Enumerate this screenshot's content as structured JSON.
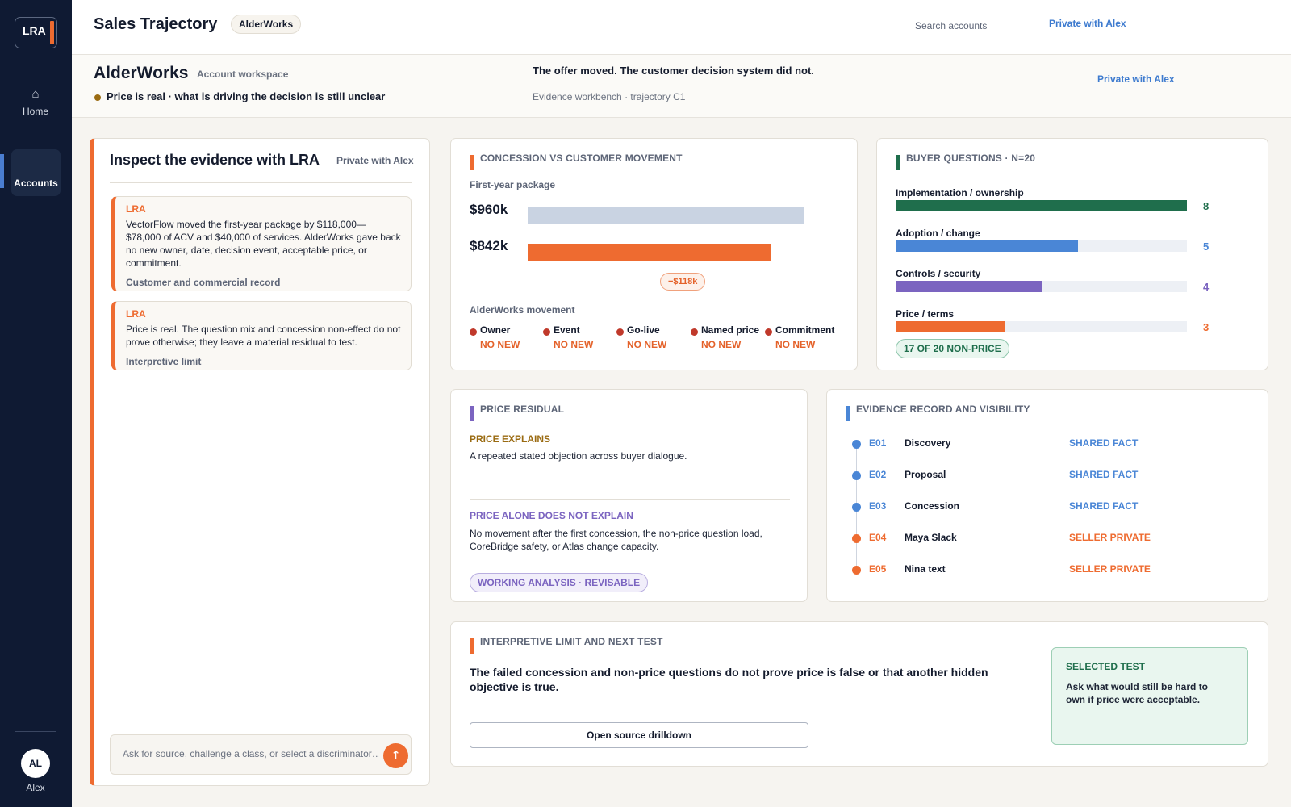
{
  "app": {
    "logo": "LRA",
    "title": "Sales Trajectory",
    "account_chip": "AlderWorks"
  },
  "nav": {
    "home_label": "Home",
    "accounts_label": "Accounts",
    "home_icon": "home-icon",
    "user_initials": "AL",
    "user_name": "Alex"
  },
  "header": {
    "search_placeholder": "Search accounts",
    "privacy": "Private with Alex"
  },
  "account": {
    "name": "AlderWorks",
    "subtitle": "Account workspace",
    "status": "Price is real · what is driving the decision is still unclear",
    "status_color": "#9a6b12",
    "headline": "The offer moved. The customer decision system did not.",
    "headline_sub": "Evidence workbench · trajectory C1",
    "privacy": "Private with Alex"
  },
  "inspect": {
    "title": "Inspect the evidence with LRA",
    "privacy": "Private with Alex",
    "messages": [
      {
        "from": "LRA",
        "body": "VectorFlow moved the first-year package by $118,000—$78,000 of ACV and $40,000 of services. AlderWorks gave back no new owner, date, decision event, acceptable price, or commitment.",
        "source": "Customer and commercial record"
      },
      {
        "from": "LRA",
        "body": "Price is real. The question mix and concession non-effect do not prove otherwise; they leave a material residual to test.",
        "source": "Interpretive limit"
      }
    ],
    "compose_placeholder": "Ask for source, challenge a class, or select a discriminator…",
    "send_icon": "↑"
  },
  "concession": {
    "title": "CONCESSION VS CUSTOMER MOVEMENT",
    "accent": "#ee6b30",
    "package_label": "First-year package",
    "before_label": "$960k",
    "after_label": "$842k",
    "before_value": 960,
    "after_value": 842,
    "delta": "−$118k",
    "movement_label": "AlderWorks movement",
    "movement": [
      {
        "name": "Owner",
        "value": "NO NEW"
      },
      {
        "name": "Event",
        "value": "NO NEW"
      },
      {
        "name": "Go-live",
        "value": "NO NEW"
      },
      {
        "name": "Named price",
        "value": "NO NEW"
      },
      {
        "name": "Commitment",
        "value": "NO NEW"
      }
    ]
  },
  "questions": {
    "title": "BUYER QUESTIONS · N=20",
    "accent": "#1f6e4c",
    "total": 20,
    "items": [
      {
        "label": "Implementation / ownership",
        "count": 8,
        "color": "#1f6e4c"
      },
      {
        "label": "Adoption / change",
        "count": 5,
        "color": "#4a86d6"
      },
      {
        "label": "Controls / security",
        "count": 4,
        "color": "#7b64c0"
      },
      {
        "label": "Price / terms",
        "count": 3,
        "color": "#ee6b30"
      }
    ],
    "summary": "17 OF 20 NON-PRICE"
  },
  "residual": {
    "title": "PRICE RESIDUAL",
    "accent": "#7b64c0",
    "explains_heading": "PRICE EXPLAINS",
    "explains_body": "A repeated stated objection across buyer dialogue.",
    "not_heading": "PRICE ALONE DOES NOT EXPLAIN",
    "not_body": "No movement after the first concession, the non-price question load, CoreBridge safety, or Atlas change capacity.",
    "badge": "WORKING ANALYSIS · REVISABLE"
  },
  "evidence": {
    "title": "EVIDENCE RECORD AND VISIBILITY",
    "accent": "#4a86d6",
    "rows": [
      {
        "id": "E01",
        "name": "Discovery",
        "visibility": "SHARED FACT",
        "color": "#4a86d6"
      },
      {
        "id": "E02",
        "name": "Proposal",
        "visibility": "SHARED FACT",
        "color": "#4a86d6"
      },
      {
        "id": "E03",
        "name": "Concession",
        "visibility": "SHARED FACT",
        "color": "#4a86d6"
      },
      {
        "id": "E04",
        "name": "Maya Slack",
        "visibility": "SELLER PRIVATE",
        "color": "#ee6b30"
      },
      {
        "id": "E05",
        "name": "Nina text",
        "visibility": "SELLER PRIVATE",
        "color": "#ee6b30"
      }
    ]
  },
  "limit": {
    "title": "INTERPRETIVE LIMIT AND NEXT TEST",
    "accent": "#ee6b30",
    "statement": "The failed concession and non-price questions do not prove price is false or that another hidden objective is true.",
    "button": "Open source drilldown",
    "selected_heading": "SELECTED TEST",
    "selected_body": "Ask what would still be hard to own if price were acceptable."
  }
}
